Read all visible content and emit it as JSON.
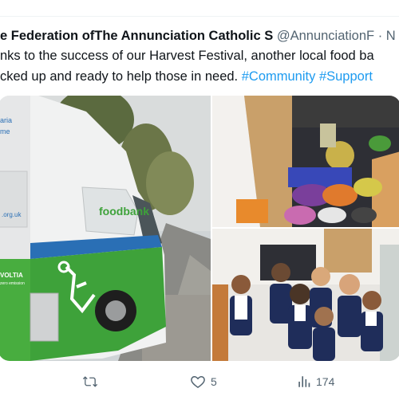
{
  "tweet": {
    "author_name": "e Federation ofThe Annunciation Catholic S",
    "handle": "@AnnunciationF",
    "separator": "·",
    "time": "N",
    "text_lines": [
      "nks to the success of our Harvest Festival, another local food ba",
      "cked up and ready to help those in need. "
    ],
    "hashtags": [
      "#Community",
      "#Support"
    ]
  },
  "media": {
    "van_text": {
      "brand": "foodbank",
      "door_text": "aria",
      "door_text2": "me",
      "url": ".org.uk",
      "sponsor": "VOLTIA",
      "sponsor_sub": "zero emission"
    }
  },
  "actions": {
    "reply_label": "",
    "retweet_count": "",
    "like_count": "5",
    "views_count": "174"
  },
  "colors": {
    "accent": "#1d9bf0",
    "muted": "#536471",
    "van_green": "#3ea23a",
    "van_blue": "#2a6fb5"
  }
}
